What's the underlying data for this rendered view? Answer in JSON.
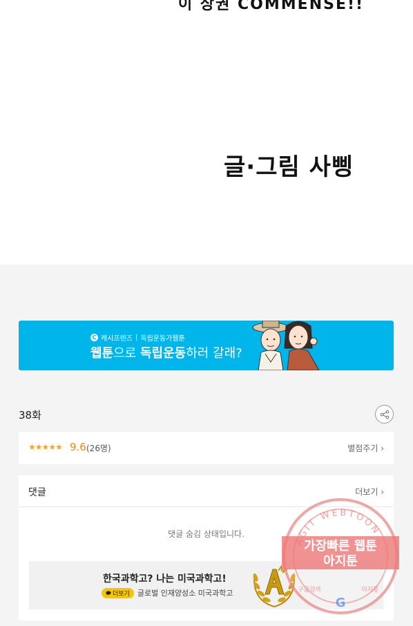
{
  "comic": {
    "top_text": "이 상권 COMMENSE!!",
    "credit": "글·그림 사삥"
  },
  "banner": {
    "brand": "캐시프렌즈",
    "tagline": "독립운동가웹툰",
    "headline_pre": "웹툰",
    "headline_mid": "으로 ",
    "headline_bold": "독립운동",
    "headline_post": "하러 갈래?"
  },
  "episode": {
    "title": "38화"
  },
  "rating": {
    "stars": "★★★★★",
    "score": "9.6",
    "count": "(26명)",
    "rate_link": "별점주기 ›"
  },
  "comments": {
    "title": "댓글",
    "more_link": "더보기 ›",
    "hidden_message": "댓글 숨김 상태입니다."
  },
  "ad": {
    "title": "한국과학고? 나는 미국과학고!",
    "more_label": "더보기",
    "subtitle": "글로벌 인재양성소 미국과학고"
  },
  "watermark": {
    "ring_text": "AGIT WEBTOON",
    "line1": "가장빠른 웹툰",
    "line2": "아지툰",
    "small_left": "구글검색",
    "small_right": "아지툰"
  },
  "colors": {
    "banner_bg": "#00b5e9",
    "star": "#f5a623",
    "score": "#f08a00",
    "ad_badge": "#f7c500",
    "watermark": "#e05a5a"
  },
  "icons": {
    "share": "share-icon",
    "brand": "cash-friends-icon",
    "speech": "speech-bubble-icon"
  }
}
